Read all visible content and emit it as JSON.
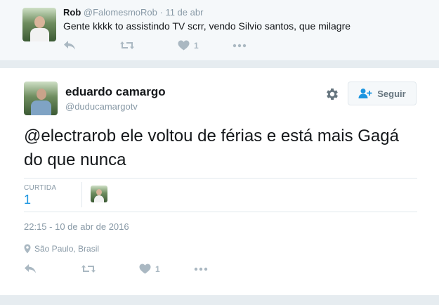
{
  "parent_tweet": {
    "name": "Rob",
    "handle": "@FalomesmoRob",
    "separator": "·",
    "date": "11 de abr",
    "text": "Gente kkkk to assistindo TV scrr, vendo Silvio santos, que milagre",
    "like_count": "1"
  },
  "main_tweet": {
    "name": "eduardo camargo",
    "handle": "@duducamargotv",
    "follow_label": "Seguir",
    "text": "@electrarob ele voltou de férias e está mais Gagá do que nunca",
    "stats": {
      "label": "CURTIDA",
      "value": "1"
    },
    "datetime": "22:15 - 10 de abr de 2016",
    "location": "São Paulo, Brasil",
    "like_count": "1"
  },
  "icons": {
    "reply": "reply-icon",
    "retweet": "retweet-icon",
    "like": "heart-icon",
    "more": "more-icon",
    "settings": "gear-icon",
    "follow": "add-user-icon",
    "location": "location-pin-icon"
  },
  "colors": {
    "background": "#e6ecf0",
    "parent_bg": "#f5f8fa",
    "link_blue": "#1b95e0",
    "muted_gray": "#8899a6",
    "icon_gray": "#aab8c2"
  }
}
